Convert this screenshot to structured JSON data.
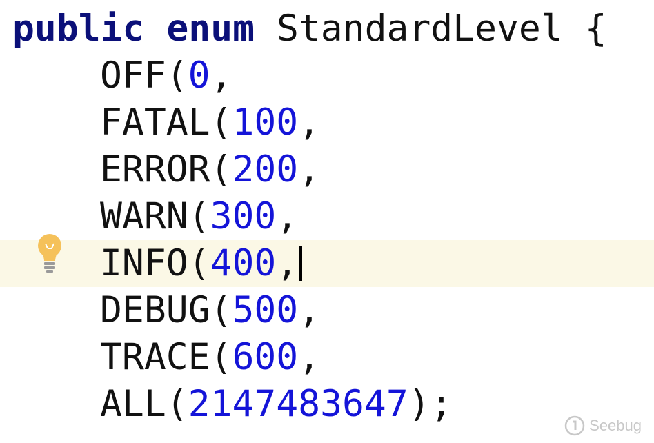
{
  "code": {
    "declaration": {
      "keyword_public": "public",
      "keyword_enum": "enum",
      "name": "StandardLevel",
      "brace": "{"
    },
    "constants": [
      {
        "name": "OFF",
        "value": "0",
        "end": ","
      },
      {
        "name": "FATAL",
        "value": "100",
        "end": ","
      },
      {
        "name": "ERROR",
        "value": "200",
        "end": ","
      },
      {
        "name": "WARN",
        "value": "300",
        "end": ","
      },
      {
        "name": "INFO",
        "value": "400",
        "end": ","
      },
      {
        "name": "DEBUG",
        "value": "500",
        "end": ","
      },
      {
        "name": "TRACE",
        "value": "600",
        "end": ","
      },
      {
        "name": "ALL",
        "value": "2147483647",
        "end": ");"
      }
    ],
    "current_line_index": 4
  },
  "icons": {
    "intention": "lightbulb-icon",
    "watermark_logo": "seebug-logo-icon"
  },
  "watermark": {
    "text": "Seebug"
  },
  "colors": {
    "keyword": "#0b1079",
    "number": "#1414d8",
    "text": "#111111",
    "current_line": "#fbf8e6",
    "bulb": "#f5c15a"
  }
}
